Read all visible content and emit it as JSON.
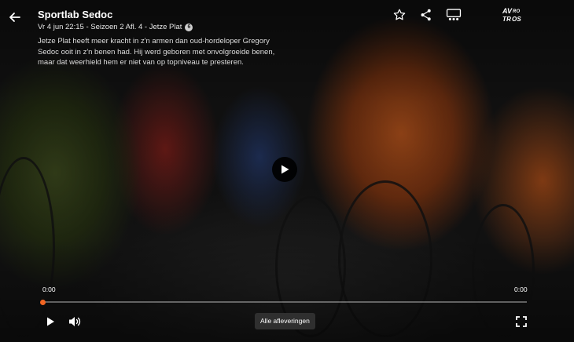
{
  "video": {
    "title": "Sportlab Sedoc",
    "meta": "Vr 4 jun 22:15 - Seizoen 2 Afl. 4 - Jetze Plat",
    "age_rating": "6",
    "description": "Jetze Plat heeft meer kracht in z'n armen dan oud-hordeloper Gregory Sedoc ooit in z'n benen had. Hij werd geboren met onvolgroeide benen, maar dat weerhield hem er niet van op topniveau te presteren."
  },
  "header": {
    "back_icon": "arrow-left-icon",
    "favorite_icon": "star-icon",
    "share_icon": "share-icon",
    "cast_icon": "cast-icon",
    "logo_text": "AVROTROS"
  },
  "player": {
    "elapsed": "0:00",
    "duration": "0:00",
    "progress": 0,
    "accent_color": "#f26522",
    "play_icon": "play-icon",
    "volume_icon": "volume-icon",
    "fullscreen_icon": "fullscreen-icon",
    "all_episodes_label": "Alle afleveringen"
  }
}
